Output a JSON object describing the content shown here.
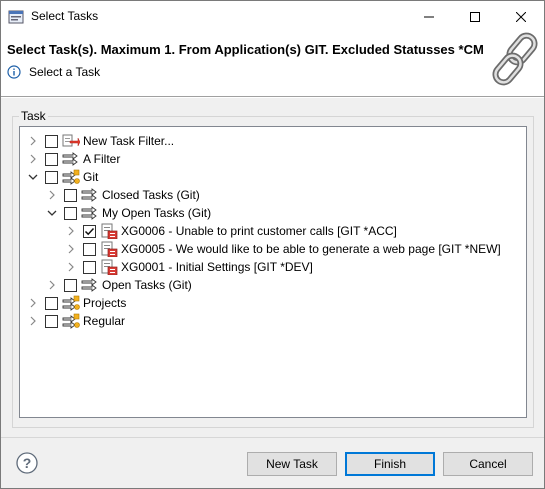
{
  "window": {
    "title": "Select Tasks"
  },
  "header": {
    "title": "Select Task(s). Maximum 1. From Application(s) GIT. Excluded Statusses *CM",
    "message": "Select a Task"
  },
  "group": {
    "label": "Task"
  },
  "tree": {
    "items": [
      {
        "label": "New Task Filter...",
        "level": 0,
        "expander": "collapsed",
        "checked": false,
        "icon": "new-filter-icon"
      },
      {
        "label": "A Filter",
        "level": 0,
        "expander": "collapsed",
        "checked": false,
        "icon": "filter-icon"
      },
      {
        "label": "Git",
        "level": 0,
        "expander": "expanded",
        "checked": false,
        "icon": "app-folder-icon"
      },
      {
        "label": "Closed Tasks (Git)",
        "level": 1,
        "expander": "collapsed",
        "checked": false,
        "icon": "filter-icon"
      },
      {
        "label": "My Open Tasks (Git)",
        "level": 1,
        "expander": "expanded",
        "checked": false,
        "icon": "filter-icon"
      },
      {
        "label": "XG0006 - Unable to print customer calls [GIT *ACC]",
        "level": 2,
        "expander": "collapsed",
        "checked": true,
        "icon": "task-icon"
      },
      {
        "label": "XG0005 - We would like to be able to generate a web page [GIT *NEW]",
        "level": 2,
        "expander": "collapsed",
        "checked": false,
        "icon": "task-icon"
      },
      {
        "label": "XG0001 - Initial Settings [GIT *DEV]",
        "level": 2,
        "expander": "collapsed",
        "checked": false,
        "icon": "task-icon"
      },
      {
        "label": "Open Tasks (Git)",
        "level": 1,
        "expander": "collapsed",
        "checked": false,
        "icon": "filter-icon"
      },
      {
        "label": "Projects",
        "level": 0,
        "expander": "collapsed",
        "checked": false,
        "icon": "app-folder-icon"
      },
      {
        "label": "Regular",
        "level": 0,
        "expander": "collapsed",
        "checked": false,
        "icon": "app-folder-icon"
      }
    ]
  },
  "buttons": {
    "new_task": "New Task",
    "finish": "Finish",
    "cancel": "Cancel"
  }
}
